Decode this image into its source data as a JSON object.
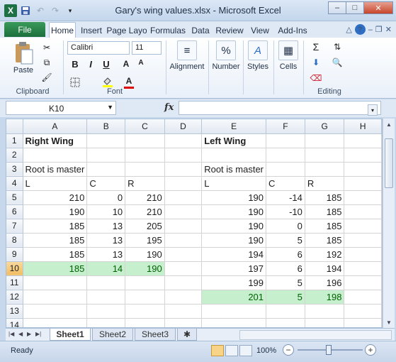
{
  "window": {
    "title": "Gary's wing values.xlsx  -  Microsoft Excel",
    "app_icon": "X",
    "min": "–",
    "max": "□",
    "close": "✕"
  },
  "ribbon_tabs": [
    {
      "label": "File"
    },
    {
      "label": "Home"
    },
    {
      "label": "Insert"
    },
    {
      "label": "Page Layo"
    },
    {
      "label": "Formulas"
    },
    {
      "label": "Data"
    },
    {
      "label": "Review"
    },
    {
      "label": "View"
    },
    {
      "label": "Add-Ins"
    }
  ],
  "ribbon": {
    "clipboard": {
      "paste": "Paste",
      "label": "Clipboard"
    },
    "font": {
      "name": "Calibri",
      "size": "11",
      "bold": "B",
      "italic": "I",
      "underline": "U",
      "grow": "A",
      "shrink": "A",
      "color_letter": "A",
      "label": "Font"
    },
    "alignment": {
      "label": "Alignment"
    },
    "number": {
      "label": "Number"
    },
    "styles": {
      "label": "Styles"
    },
    "cells": {
      "label": "Cells"
    },
    "editing": {
      "label": "Editing"
    }
  },
  "formula_bar": {
    "name_box": "K10",
    "fx": "fx",
    "value": ""
  },
  "columns": [
    "A",
    "B",
    "C",
    "D",
    "E",
    "F",
    "G",
    "H"
  ],
  "rows": [
    {
      "n": "1",
      "cells": [
        "Right Wing",
        "",
        "",
        "",
        "Left Wing",
        "",
        "",
        ""
      ]
    },
    {
      "n": "2",
      "cells": [
        "",
        "",
        "",
        "",
        "",
        "",
        "",
        ""
      ]
    },
    {
      "n": "3",
      "cells": [
        "Root is master",
        "",
        "",
        "",
        "Root is master",
        "",
        "",
        ""
      ]
    },
    {
      "n": "4",
      "cells": [
        "L",
        "C",
        "R",
        "",
        "L",
        "C",
        "R",
        ""
      ]
    },
    {
      "n": "5",
      "cells": [
        "210",
        "0",
        "210",
        "",
        "190",
        "-14",
        "185",
        ""
      ]
    },
    {
      "n": "6",
      "cells": [
        "190",
        "10",
        "210",
        "",
        "190",
        "-10",
        "185",
        ""
      ]
    },
    {
      "n": "7",
      "cells": [
        "185",
        "13",
        "205",
        "",
        "190",
        "0",
        "185",
        ""
      ]
    },
    {
      "n": "8",
      "cells": [
        "185",
        "13",
        "195",
        "",
        "190",
        "5",
        "185",
        ""
      ]
    },
    {
      "n": "9",
      "cells": [
        "185",
        "13",
        "190",
        "",
        "194",
        "6",
        "192",
        ""
      ]
    },
    {
      "n": "10",
      "cells": [
        "185",
        "14",
        "190",
        "",
        "197",
        "6",
        "194",
        ""
      ]
    },
    {
      "n": "11",
      "cells": [
        "",
        "",
        "",
        "",
        "199",
        "5",
        "196",
        ""
      ]
    },
    {
      "n": "12",
      "cells": [
        "",
        "",
        "",
        "",
        "201",
        "5",
        "198",
        ""
      ]
    },
    {
      "n": "13",
      "cells": [
        "",
        "",
        "",
        "",
        "",
        "",
        "",
        ""
      ]
    },
    {
      "n": "14",
      "cells": [
        "",
        "",
        "",
        "",
        "",
        "",
        "",
        ""
      ]
    }
  ],
  "sheets": [
    {
      "label": "Sheet1",
      "active": true
    },
    {
      "label": "Sheet2",
      "active": false
    },
    {
      "label": "Sheet3",
      "active": false
    }
  ],
  "status": {
    "ready": "Ready",
    "zoom": "100%",
    "zoom_minus": "−",
    "zoom_plus": "+"
  },
  "colors": {
    "highlight_bg": "#c6efce",
    "highlight_text": "#006100",
    "file_tab": "#1d6f3d"
  }
}
